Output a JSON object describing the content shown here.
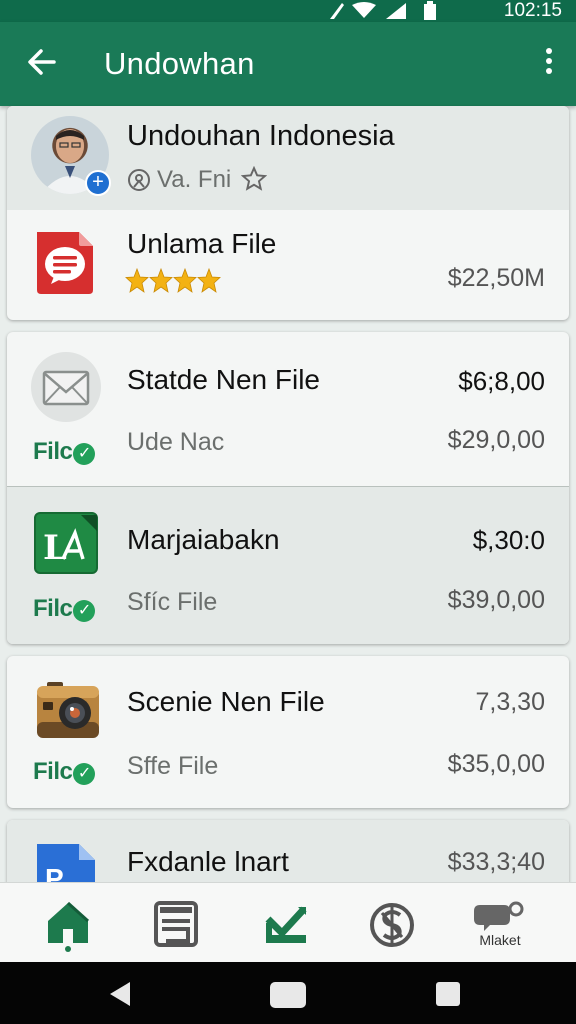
{
  "status_bar": {
    "time": "102:15"
  },
  "app_bar": {
    "title": "Undowhan"
  },
  "profile": {
    "name": "Undouhan Indonesia",
    "meta": "Va. Fni"
  },
  "featured": {
    "title": "Unlama File",
    "rating": 4,
    "price": "$22,50M"
  },
  "items": [
    {
      "title": "Statde Nen File",
      "price_top": "$6;8,00",
      "sub": "Ude Nac",
      "price_bottom": "$29,0,00",
      "badge": "Filc",
      "icon": "mail-icon"
    },
    {
      "title": "Marjaiabakn",
      "price_top": "$,30:0",
      "sub": "Sfíc File",
      "price_bottom": "$39,0,00",
      "badge": "Filc",
      "icon": "spreadsheet-icon"
    },
    {
      "title": "Scenie Nen File",
      "price_top": "7,3,30",
      "sub": "Sffe File",
      "price_bottom": "$35,0,00",
      "badge": "Filc",
      "icon": "camera-icon"
    },
    {
      "title": "Fxdanle lnart",
      "price_top": "$33,3;40",
      "icon": "presentation-icon"
    }
  ],
  "bottom_nav": [
    {
      "icon": "home-icon",
      "label": ""
    },
    {
      "icon": "documents-icon",
      "label": ""
    },
    {
      "icon": "download-icon",
      "label": ""
    },
    {
      "icon": "currency-icon",
      "label": ""
    },
    {
      "icon": "market-chat-icon",
      "label": "Mlaket"
    }
  ],
  "colors": {
    "appbar": "#1a7a57",
    "statusbar": "#0f6b4b",
    "accent_green": "#1d7a4d",
    "star": "#f3b213"
  }
}
